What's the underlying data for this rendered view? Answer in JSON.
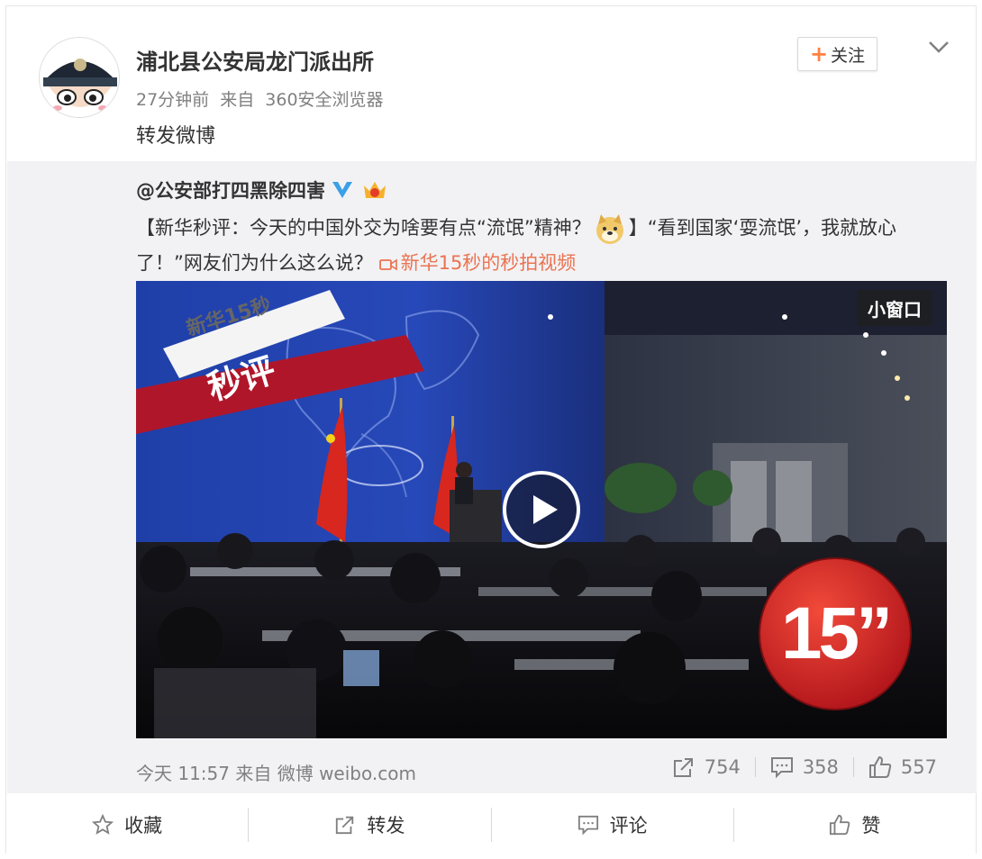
{
  "post": {
    "author": "浦北县公安局龙门派出所",
    "time": "27分钟前",
    "source_prefix": "来自",
    "source": "360安全浏览器",
    "text": "转发微博",
    "follow_label": "关注"
  },
  "repost": {
    "author": "@公安部打四黑除四害",
    "text_part1": "【新华秒评：今天的中国外交为啥要有点“流氓”精神？",
    "text_part2": "】“看到国家‘耍流氓’，我就放心了！”网友们为什么这么说？",
    "video_link": "新华15秒的秒拍视频",
    "video": {
      "mini_window_label": "小窗口",
      "ribbon_top": "新华15秒",
      "ribbon_main": "秒评",
      "badge": "15”"
    },
    "time": "今天 11:57",
    "source_prefix": "来自",
    "source": "微博 weibo.com",
    "stats": {
      "reposts": "754",
      "comments": "358",
      "likes": "557"
    }
  },
  "actions": {
    "favorite": "收藏",
    "repost": "转发",
    "comment": "评论",
    "like": "赞"
  },
  "colors": {
    "accent_orange": "#eb7350",
    "follow_plus": "#ff8140",
    "verified_blue": "#3ba0e6",
    "ribbon_red": "#b0162a",
    "badge_red": "#d51d1d"
  }
}
